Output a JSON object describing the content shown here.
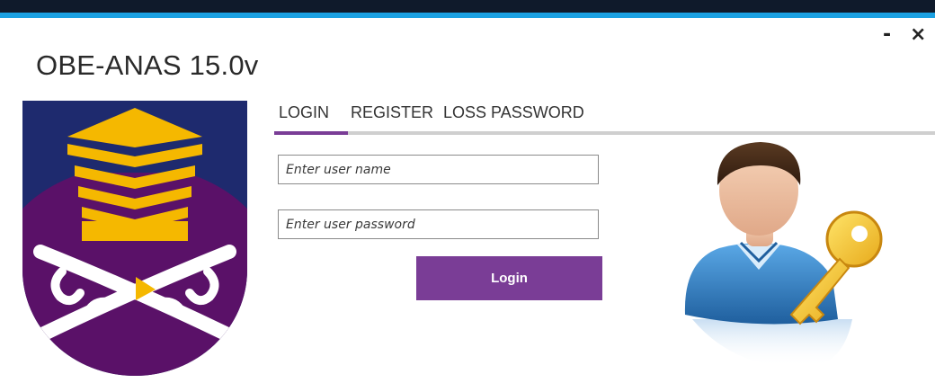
{
  "window": {
    "title": "OBE-ANAS 15.0v",
    "minimize_label": "-",
    "close_label": "×"
  },
  "tabs": [
    {
      "label": "LOGIN",
      "active": true
    },
    {
      "label": "REGISTER",
      "active": false
    },
    {
      "label": "LOSS PASSWORD",
      "active": false
    }
  ],
  "form": {
    "username_placeholder": "Enter user name",
    "username_value": "",
    "password_placeholder": "Enter user password",
    "password_value": "",
    "login_label": "Login"
  },
  "colors": {
    "accent": "#7a3d96",
    "titlebar_blue": "#1ba1e2",
    "logo_navy": "#1e2a6e",
    "logo_purple": "#5a1168",
    "logo_gold": "#f5b800"
  },
  "icons": {
    "logo": "university-crest-logo",
    "user": "user-key-icon"
  }
}
